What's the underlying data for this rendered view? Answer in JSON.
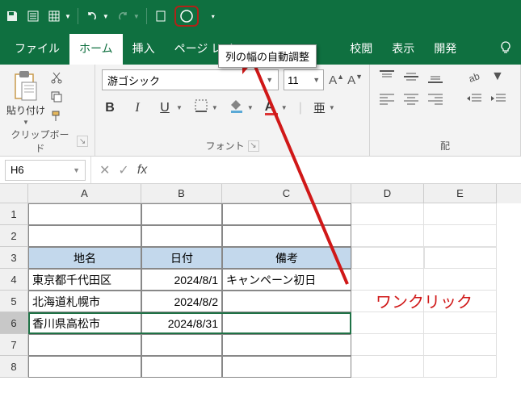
{
  "qat": {
    "icons": [
      "save",
      "page",
      "table",
      "undo",
      "redo",
      "touch",
      "circle"
    ]
  },
  "tooltip": "列の幅の自動調整",
  "tabs": {
    "items": [
      "ファイル",
      "ホーム",
      "挿入",
      "ページ レイ",
      "",
      "",
      "校閲",
      "表示",
      "開発"
    ],
    "active": 1
  },
  "ribbon": {
    "clipboard": {
      "paste": "貼り付け",
      "group_label": "クリップボード"
    },
    "font": {
      "name": "游ゴシック",
      "size": "11",
      "group_label": "フォント",
      "bold": "B",
      "italic": "I",
      "underline": "U"
    },
    "align": {
      "group_label": "配"
    }
  },
  "formula_bar": {
    "cell_ref": "H6"
  },
  "grid": {
    "columns": [
      "A",
      "B",
      "C",
      "D",
      "E"
    ],
    "rows": [
      {
        "n": "1",
        "cells": [
          "",
          "",
          "",
          "",
          ""
        ]
      },
      {
        "n": "2",
        "cells": [
          "",
          "",
          "",
          "",
          ""
        ]
      },
      {
        "n": "3",
        "header": true,
        "cells": [
          "地名",
          "日付",
          "備考",
          "",
          ""
        ]
      },
      {
        "n": "4",
        "cells": [
          "東京都千代田区",
          "2024/8/1",
          "キャンペーン初日",
          "",
          ""
        ]
      },
      {
        "n": "5",
        "cells": [
          "北海道札幌市",
          "2024/8/2",
          "",
          "",
          ""
        ]
      },
      {
        "n": "6",
        "selected": true,
        "cells": [
          "香川県高松市",
          "2024/8/31",
          "",
          "",
          ""
        ]
      },
      {
        "n": "7",
        "cells": [
          "",
          "",
          "",
          "",
          ""
        ]
      },
      {
        "n": "8",
        "cells": [
          "",
          "",
          "",
          "",
          ""
        ]
      }
    ]
  },
  "annotation": {
    "text": "ワンクリック"
  }
}
